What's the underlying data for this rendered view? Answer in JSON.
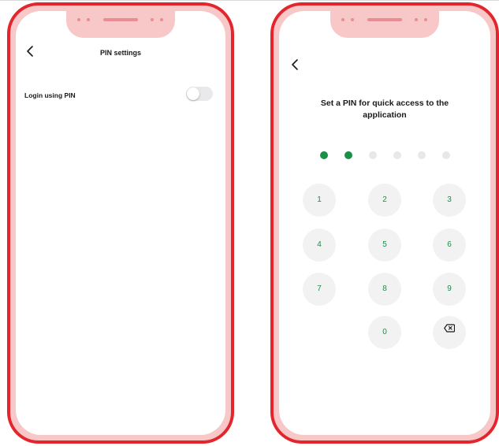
{
  "left_screen": {
    "title": "PIN settings",
    "login_row": {
      "label": "Login using PIN",
      "toggle_on": false
    }
  },
  "right_screen": {
    "heading": "Set a PIN for quick access to the application",
    "pin_length": 6,
    "pin_filled": 2,
    "keypad": {
      "k1": "1",
      "k2": "2",
      "k3": "3",
      "k4": "4",
      "k5": "5",
      "k6": "6",
      "k7": "7",
      "k8": "8",
      "k9": "9",
      "k0": "0"
    }
  },
  "colors": {
    "frame": "#e3262d",
    "bezel": "#f8c8c8",
    "accent": "#1b8e47",
    "dot_empty": "#e8e8e8",
    "key_bg": "#f2f2f2"
  },
  "icons": [
    "back-chevron-icon",
    "backspace-icon"
  ]
}
